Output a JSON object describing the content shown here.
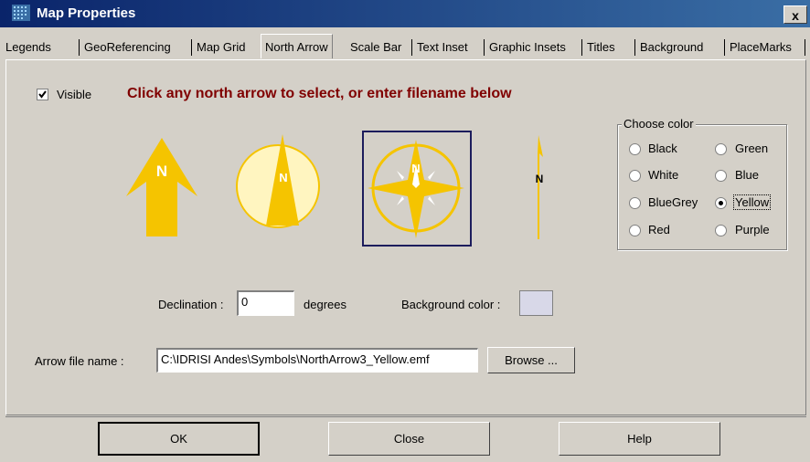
{
  "window": {
    "title": "Map Properties",
    "close_label": "x"
  },
  "tabs": [
    {
      "label": "Legends"
    },
    {
      "label": "GeoReferencing"
    },
    {
      "label": "Map Grid"
    },
    {
      "label": "North Arrow"
    },
    {
      "label": "Scale Bar"
    },
    {
      "label": "Text Inset"
    },
    {
      "label": "Graphic Insets"
    },
    {
      "label": "Titles"
    },
    {
      "label": "Background"
    },
    {
      "label": "PlaceMarks"
    }
  ],
  "selected_tab": "North Arrow",
  "north_arrow": {
    "visible_label": "Visible",
    "visible_checked": true,
    "instruction": "Click any north arrow to select, or enter filename below",
    "arrow_letter": "N",
    "selected_arrow_index": 2,
    "arrow_color": "#f5c400",
    "arrow_fill_light": "#fff5c0"
  },
  "choose_color": {
    "title": "Choose color",
    "options": [
      "Black",
      "Green",
      "White",
      "Blue",
      "BlueGrey",
      "Yellow",
      "Red",
      "Purple"
    ],
    "selected": "Yellow"
  },
  "declination": {
    "label": "Declination :",
    "value": "0",
    "unit": "degrees"
  },
  "background_color": {
    "label": "Background color :",
    "value": "#d8d8e8"
  },
  "arrow_file": {
    "label": "Arrow file name :",
    "value": "C:\\IDRISI Andes\\Symbols\\NorthArrow3_Yellow.emf",
    "browse_label": "Browse ..."
  },
  "buttons": {
    "ok": "OK",
    "close": "Close",
    "help": "Help"
  }
}
